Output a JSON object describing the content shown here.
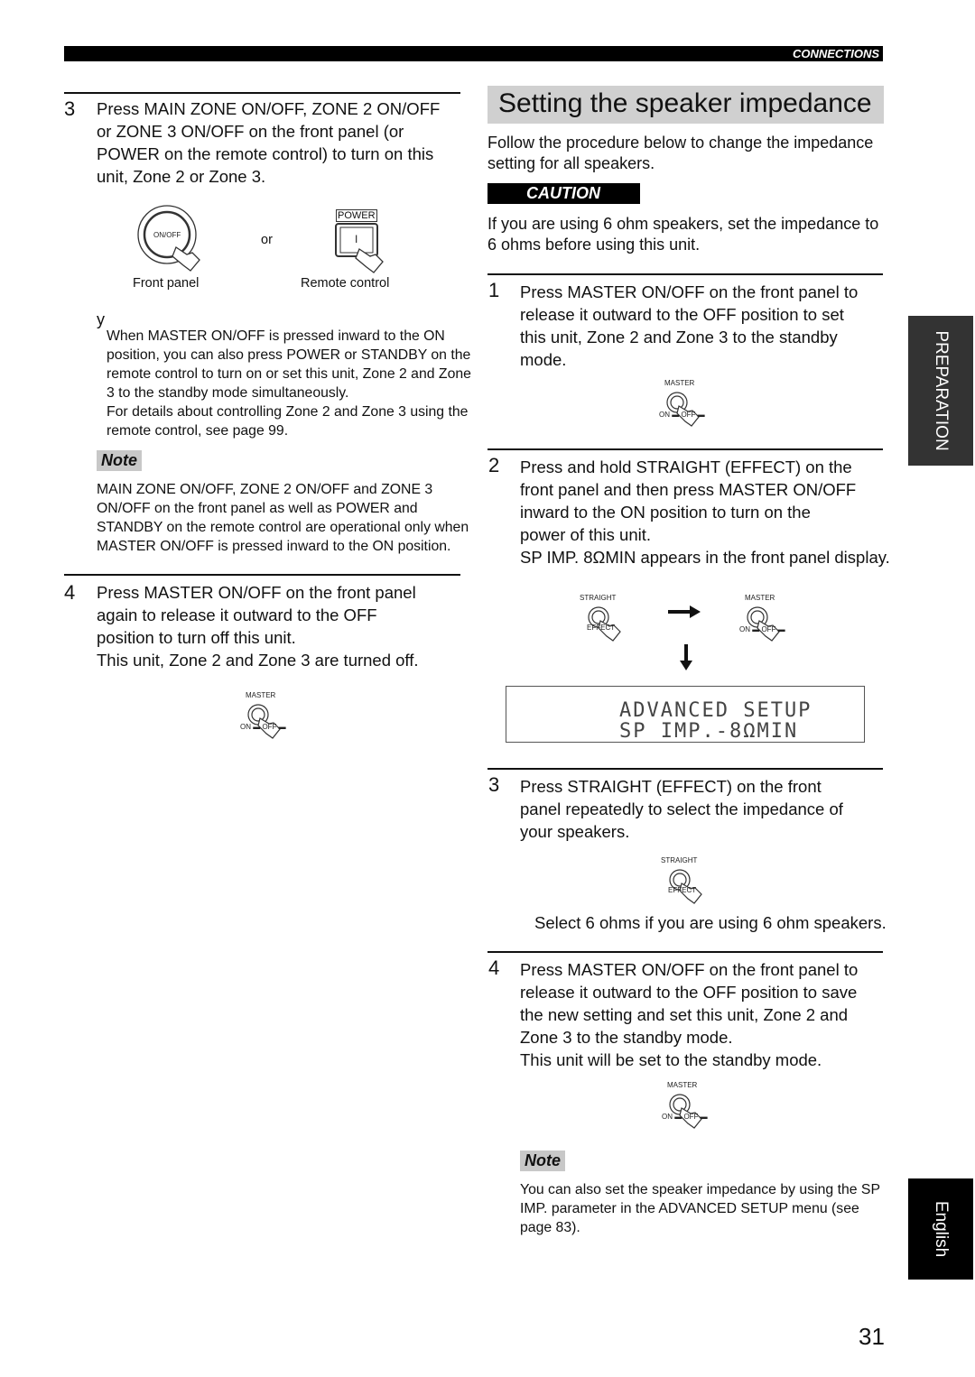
{
  "header": {
    "section": "CONNECTIONS"
  },
  "left": {
    "step3": {
      "number": "3",
      "lines": [
        "Press MAIN ZONE ON/OFF, ZONE 2 ON/OFF",
        "or ZONE 3 ON/OFF on the front panel (or",
        "POWER on the remote control) to turn on this",
        "unit, Zone 2 or Zone 3."
      ],
      "onoff_label": "ON/OFF",
      "or_label": "or",
      "power_label": "POWER",
      "power_symbol": "I",
      "front_panel_caption": "Front panel",
      "remote_caption": "Remote control"
    },
    "tip": {
      "icon": "y",
      "lines": [
        "When MASTER ON/OFF is pressed inward to the ON",
        "position, you can also press POWER or STANDBY on the",
        "remote control to turn on or set this unit, Zone 2 and Zone",
        "3 to the standby mode simultaneously.",
        "For details about controlling Zone 2 and Zone 3 using the",
        "remote control, see page 99."
      ]
    },
    "note": {
      "label": "Note",
      "lines": [
        "MAIN ZONE ON/OFF, ZONE 2 ON/OFF and ZONE 3",
        "ON/OFF on the front panel as well as POWER and",
        "STANDBY on the remote control are operational only when",
        "MASTER ON/OFF is pressed inward to the ON position."
      ]
    },
    "step4": {
      "number": "4",
      "lines": [
        "Press MASTER ON/OFF on the front panel",
        "again to release it outward to the OFF",
        "position to turn off this unit.",
        "This unit, Zone 2 and Zone 3 are turned off."
      ]
    }
  },
  "right": {
    "title": "Setting the speaker impedance",
    "intro": [
      "Follow the procedure below to change the impedance",
      "setting for all speakers."
    ],
    "caution": {
      "label": "CAUTION",
      "lines": [
        "If you are using 6 ohm speakers, set the impedance to",
        "6 ohms before using this unit."
      ]
    },
    "step1": {
      "number": "1",
      "lines": [
        "Press MASTER ON/OFF on the front panel to",
        "release it outward to the OFF position to set",
        "this unit, Zone 2 and Zone 3 to the standby",
        "mode."
      ]
    },
    "step2": {
      "number": "2",
      "lines": [
        "Press and hold STRAIGHT (EFFECT) on the",
        "front panel and then press MASTER ON/OFF",
        "inward to the ON position to turn on the",
        "power of this unit.",
        "SP IMP. 8ΩMIN appears in the front panel display."
      ]
    },
    "display": {
      "line1": "ADVANCED SETUP",
      "line2": "SP IMP.-8ΩMIN"
    },
    "step3": {
      "number": "3",
      "lines": [
        "Press STRAIGHT (EFFECT) on the front",
        "panel repeatedly to select the impedance of",
        "your speakers."
      ],
      "hint": "Select 6 ohms if you are using 6 ohm speakers."
    },
    "step4": {
      "number": "4",
      "lines": [
        "Press MASTER ON/OFF on the front panel to",
        "release it outward to the OFF position to save",
        "the new setting and set this unit, Zone 2 and",
        "Zone 3 to the standby mode.",
        "This unit will be set to the standby mode."
      ]
    },
    "note": {
      "label": "Note",
      "lines": [
        "You can also set the speaker impedance by using the SP",
        "IMP. parameter in the ADVANCED SETUP menu (see",
        "page 83)."
      ]
    }
  },
  "buttons": {
    "master": "MASTER",
    "on_off": "ON ▬ OFF ▬",
    "straight": "STRAIGHT",
    "effect": "EFFECT"
  },
  "tabs": {
    "preparation": "PREPARATION",
    "english": "English"
  },
  "page_number": "31"
}
